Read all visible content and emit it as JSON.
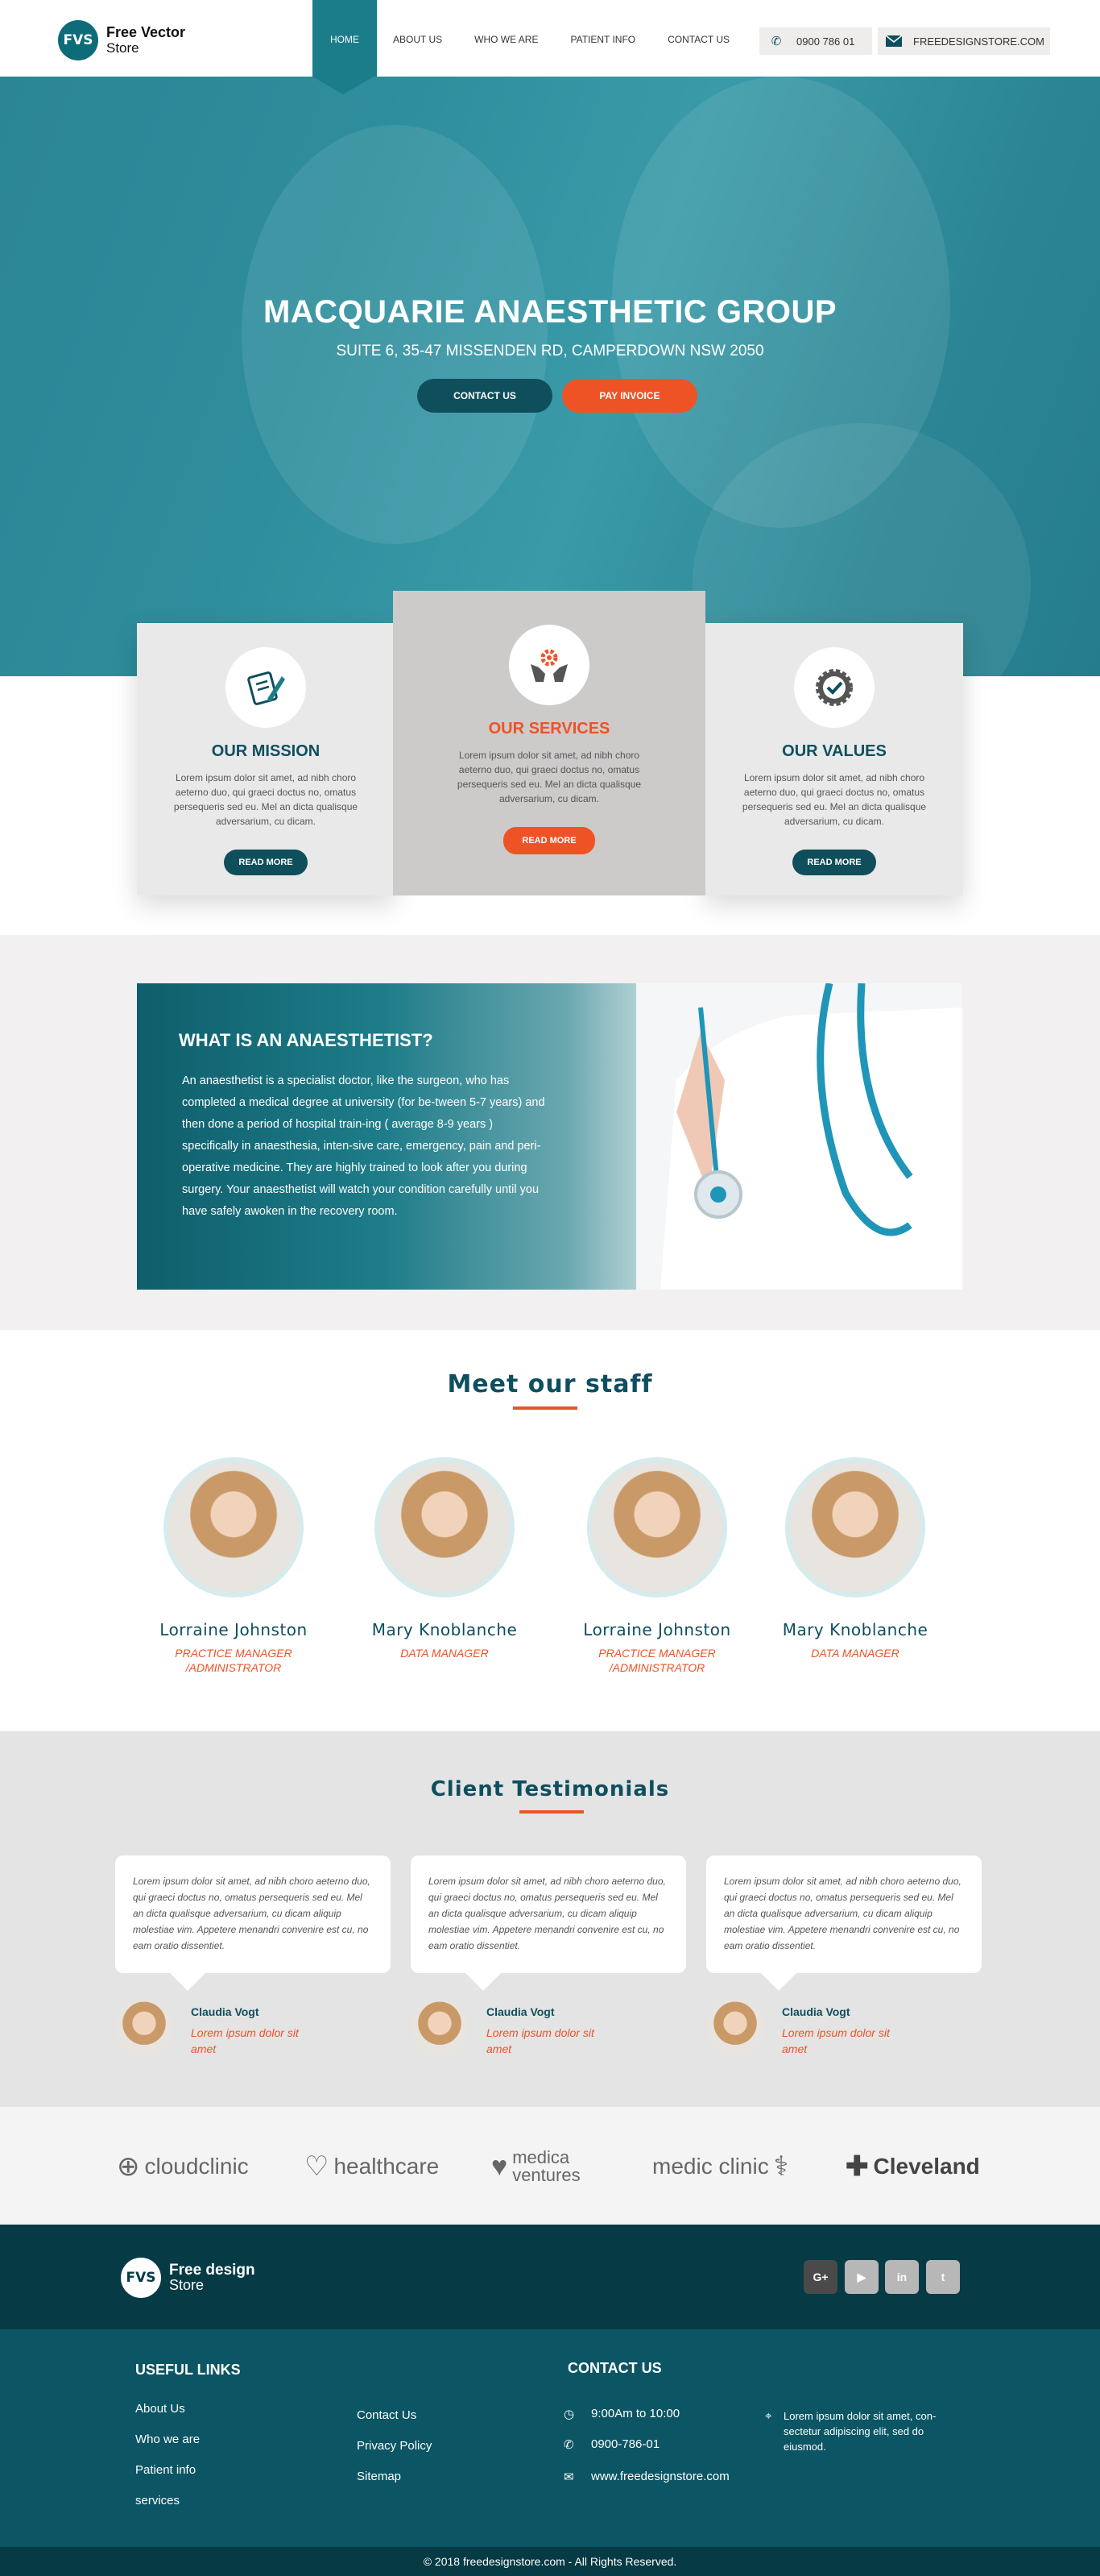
{
  "header": {
    "logo_badge": "FVS",
    "logo_line1": "Free Vector",
    "logo_line2": "Store",
    "nav": [
      "HOME",
      "ABOUT US",
      "WHO WE ARE",
      "PATIENT INFO",
      "CONTACT US"
    ],
    "phone": "0900 786 01",
    "email": "FREEDESIGNSTORE.COM",
    "phone_icon": "phone-icon",
    "mail_icon": "mail-icon"
  },
  "hero": {
    "title": "MACQUARIE ANAESTHETIC GROUP",
    "subtitle": "SUITE 6, 35-47 MISSENDEN RD, CAMPERDOWN NSW 2050",
    "contact_label": "CONTACT US",
    "pay_label": "PAY INVOICE"
  },
  "features": [
    {
      "title": "OUR MISSION",
      "text": "Lorem ipsum dolor sit amet, ad nibh choro aeterno duo, qui graeci doctus no, omatus persequeris sed eu. Mel an dicta qualisque adversarium, cu dicam.",
      "button": "READ MORE",
      "icon": "notepad-pen-icon"
    },
    {
      "title": "OUR SERVICES",
      "text": "Lorem ipsum dolor sit amet, ad nibh choro aeterno duo, qui graeci doctus no, omatus persequeris sed eu. Mel an dicta qualisque adversarium, cu dicam.",
      "button": "READ MORE",
      "icon": "hands-gear-icon"
    },
    {
      "title": "OUR VALUES",
      "text": "Lorem ipsum dolor sit amet, ad nibh choro aeterno duo, qui graeci doctus no, omatus persequeris sed eu. Mel an dicta qualisque adversarium, cu dicam.",
      "button": "READ MORE",
      "icon": "badge-check-icon"
    }
  ],
  "anaesthetist": {
    "title": "WHAT IS AN ANAESTHETIST?",
    "text": "An anaesthetist is a specialist doctor, like the surgeon, who has completed a medical degree at university (for be-tween 5-7 years) and then done a period of hospital train-ing ( average 8-9 years ) specifically in anaesthesia, inten-sive care, emergency, pain and peri-operative medicine. They are highly trained to look after you during surgery. Your anaesthetist will watch your condition carefully until you have safely awoken in the recovery room."
  },
  "staff": {
    "title": "Meet our staff",
    "members": [
      {
        "name": "Lorraine Johnston",
        "role": "PRACTICE MANAGER /ADMINISTRATOR"
      },
      {
        "name": "Mary Knoblanche",
        "role": "DATA MANAGER"
      },
      {
        "name": "Lorraine Johnston",
        "role": "PRACTICE MANAGER /ADMINISTRATOR"
      },
      {
        "name": "Mary Knoblanche",
        "role": "DATA MANAGER"
      }
    ]
  },
  "testimonials": {
    "title": "Client Testimonials",
    "items": [
      {
        "text": "Lorem ipsum dolor sit amet, ad nibh choro aeterno duo, qui graeci doctus no, omatus persequeris sed eu. Mel an dicta qualisque adversarium, cu dicam aliquip molestiae vim. Appetere menandri convenire est cu, no eam oratio dissentiet.",
        "name": "Claudia Vogt",
        "role": "Lorem ipsum dolor sit amet"
      },
      {
        "text": "Lorem ipsum dolor sit amet, ad nibh choro aeterno duo, qui graeci doctus no, omatus persequeris sed eu. Mel an dicta qualisque adversarium, cu dicam aliquip molestiae vim. Appetere menandri convenire est cu, no eam oratio dissentiet.",
        "name": "Claudia Vogt",
        "role": "Lorem ipsum dolor sit amet"
      },
      {
        "text": "Lorem ipsum dolor sit amet, ad nibh choro aeterno duo, qui graeci doctus no, omatus persequeris sed eu. Mel an dicta qualisque adversarium, cu dicam aliquip molestiae vim. Appetere menandri convenire est cu, no eam oratio dissentiet.",
        "name": "Claudia Vogt",
        "role": "Lorem ipsum dolor sit amet"
      }
    ]
  },
  "partners": [
    "cloudclinic",
    "healthcare",
    "medica ventures",
    "medic clinic",
    "Cleveland"
  ],
  "footer": {
    "logo_badge": "FVS",
    "logo_line1": "Free design",
    "logo_line2": "Store",
    "social": [
      "G+",
      "▶",
      "in",
      "t"
    ],
    "useful_links_title": "USEFUL LINKS",
    "links_col1": [
      "About Us",
      "Who we are",
      "Patient info",
      "services"
    ],
    "links_col2": [
      "Contact Us",
      "Privacy Policy",
      "Sitemap"
    ],
    "contact_title": "CONTACT US",
    "hours": "9:00Am to 10:00",
    "phone": "0900-786-01",
    "website": "www.freedesignstore.com",
    "address": "Lorem ipsum dolor sit amet, con-sectetur adipiscing elit, sed do eiusmod.",
    "copyright": "© 2018 freedesignstore.com - All Rights Reserved."
  },
  "colors": {
    "teal": "#0e4f5f",
    "orange": "#ee5326",
    "hero": "#2e8d9c"
  }
}
